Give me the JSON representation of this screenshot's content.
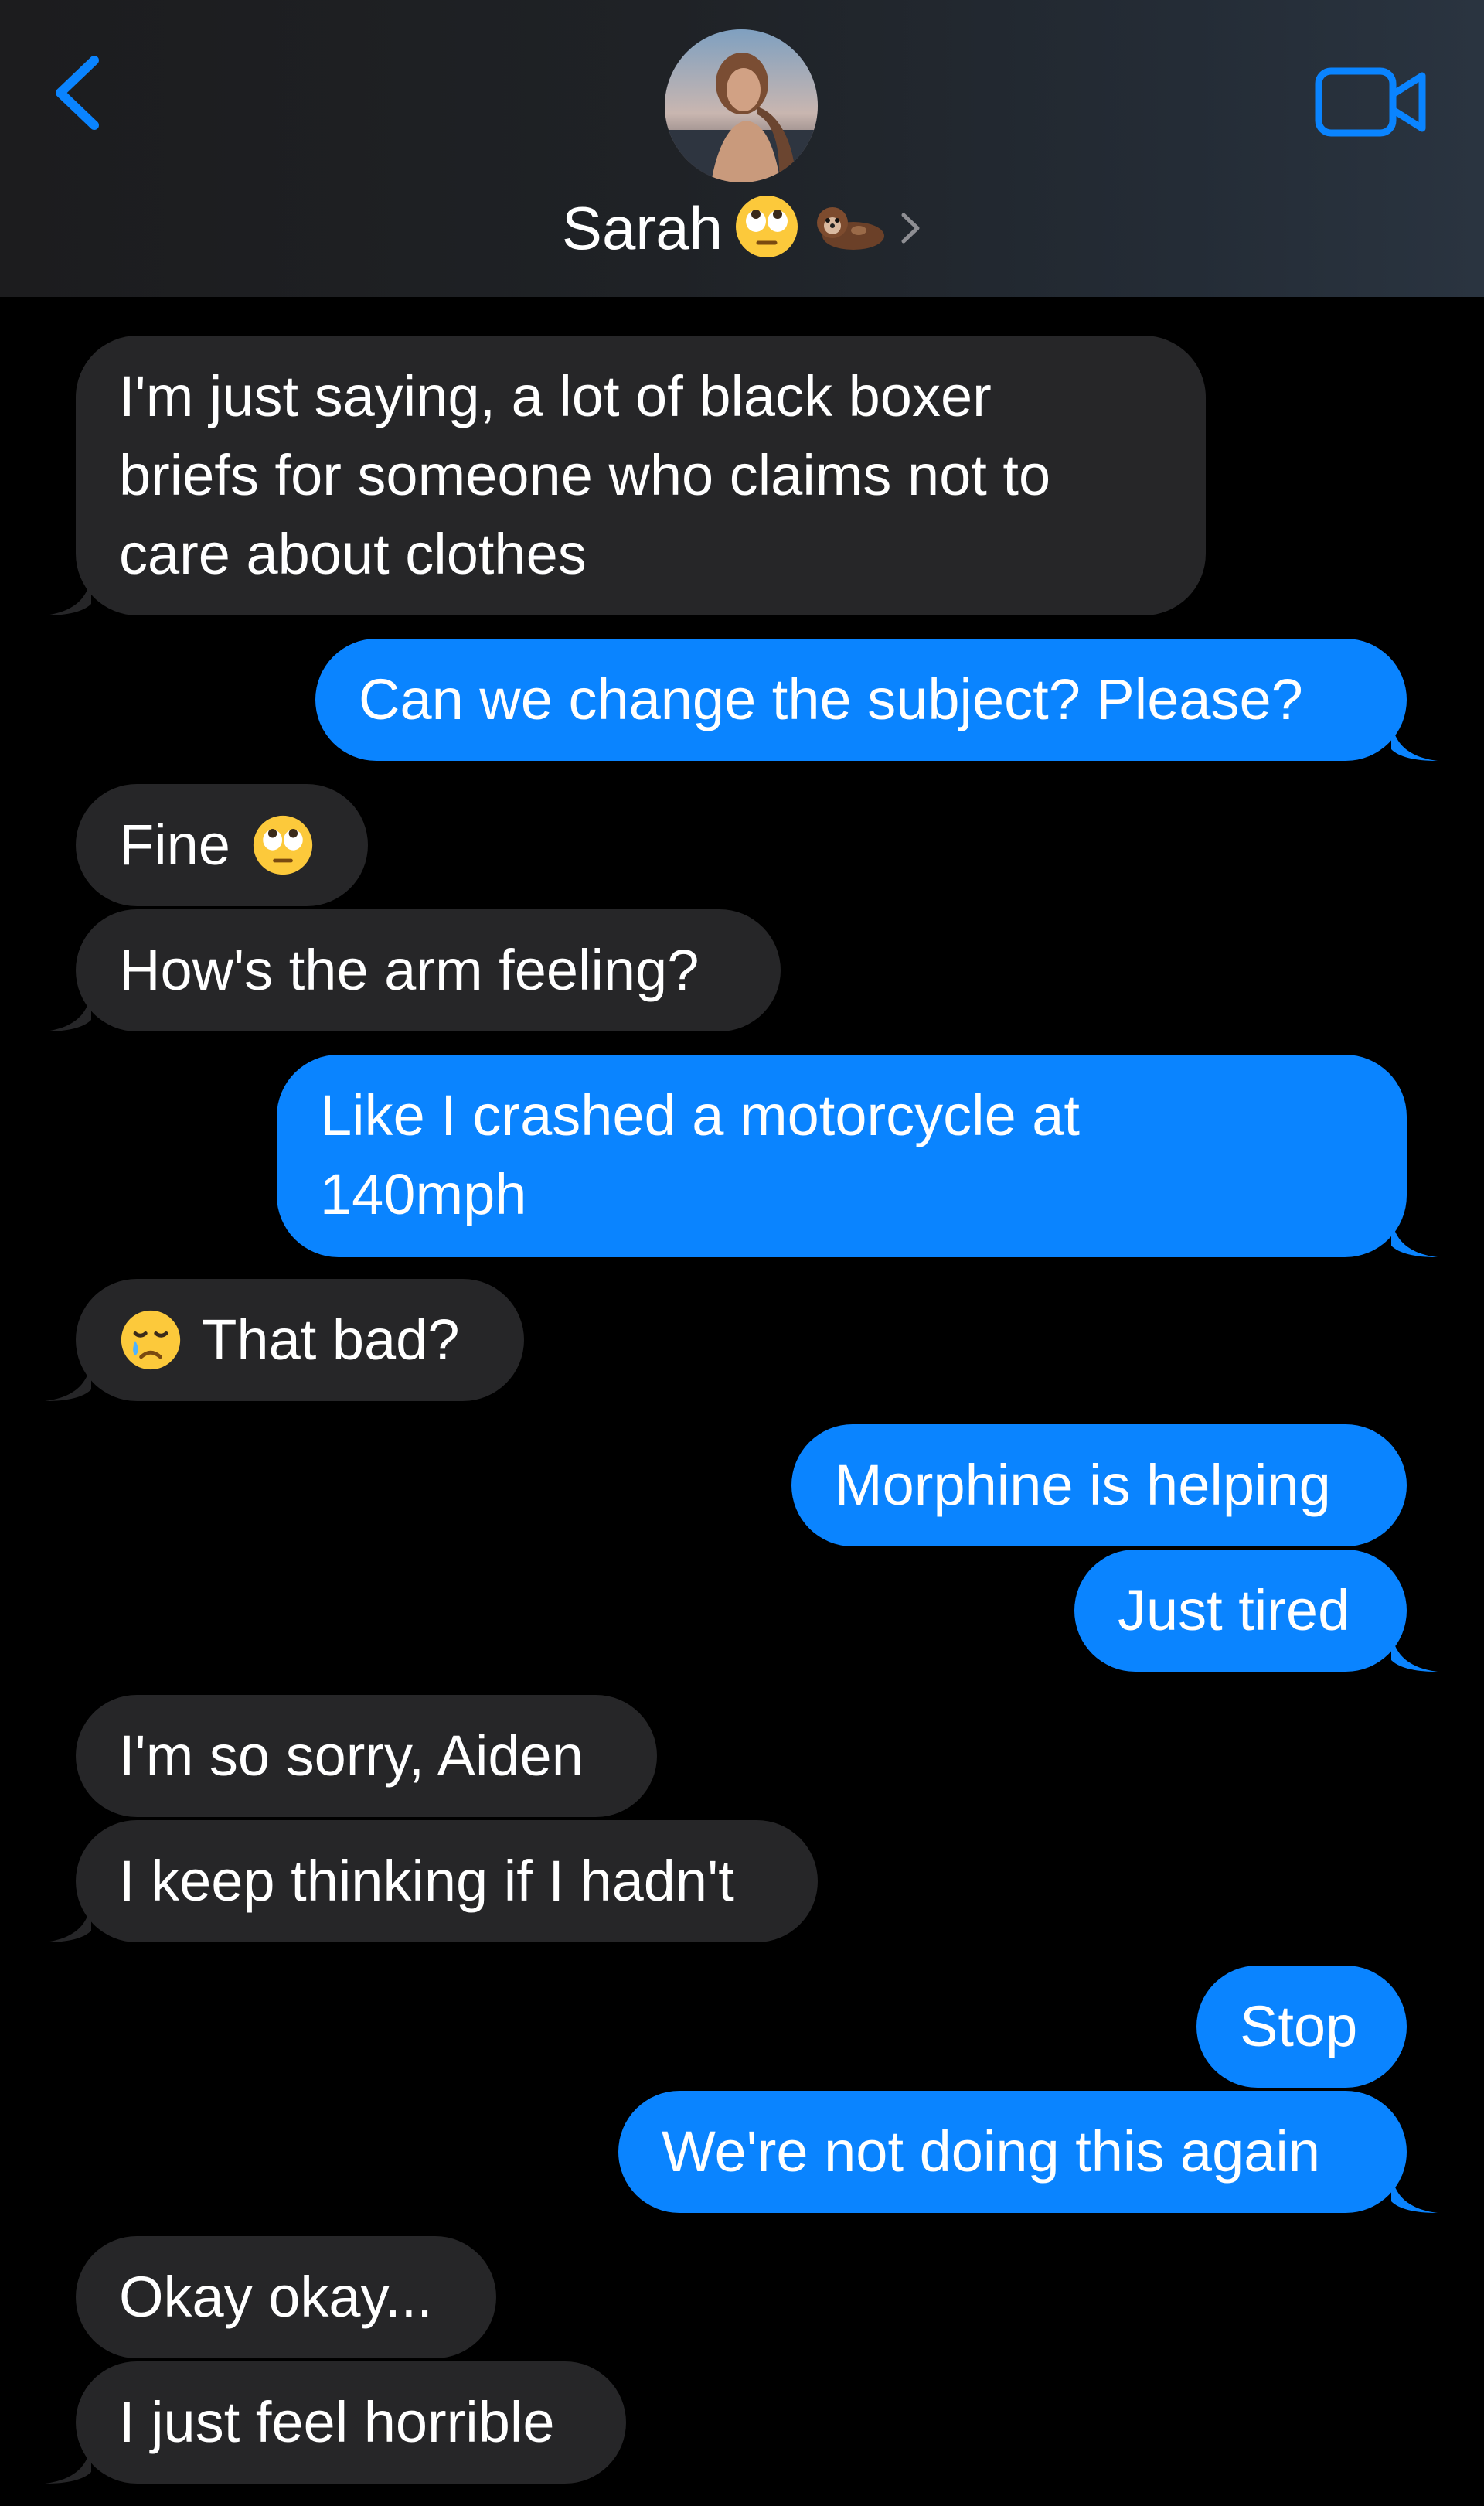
{
  "header": {
    "contact_name": "Sarah",
    "accent_color": "#0a84ff",
    "icons": [
      "back-chevron-icon",
      "avatar",
      "eye-roll-emoji",
      "otter-emoji",
      "chevron-right-icon",
      "video-camera-icon"
    ]
  },
  "messages": [
    {
      "sender": "them",
      "lines": [
        "I'm just saying, a lot of black boxer",
        "briefs for someone who claims not to",
        "care about clothes"
      ]
    },
    {
      "sender": "me",
      "text": "Can we change the subject? Please?"
    },
    {
      "sender": "them",
      "text": "Fine",
      "emoji": "eye-roll-emoji"
    },
    {
      "sender": "them",
      "text": "How's the arm feeling?"
    },
    {
      "sender": "me",
      "lines": [
        "Like I crashed a motorcycle at",
        "140mph"
      ]
    },
    {
      "sender": "them",
      "emoji": "crying-face-emoji",
      "text": "That bad?"
    },
    {
      "sender": "me",
      "text": "Morphine is helping"
    },
    {
      "sender": "me",
      "text": "Just tired"
    },
    {
      "sender": "them",
      "text": "I'm so sorry, Aiden"
    },
    {
      "sender": "them",
      "text": "I keep thinking if I hadn't"
    },
    {
      "sender": "me",
      "text": "Stop"
    },
    {
      "sender": "me",
      "text": "We're not doing this again"
    },
    {
      "sender": "them",
      "text": "Okay okay..."
    },
    {
      "sender": "them",
      "text": "I just feel horrible"
    }
  ]
}
